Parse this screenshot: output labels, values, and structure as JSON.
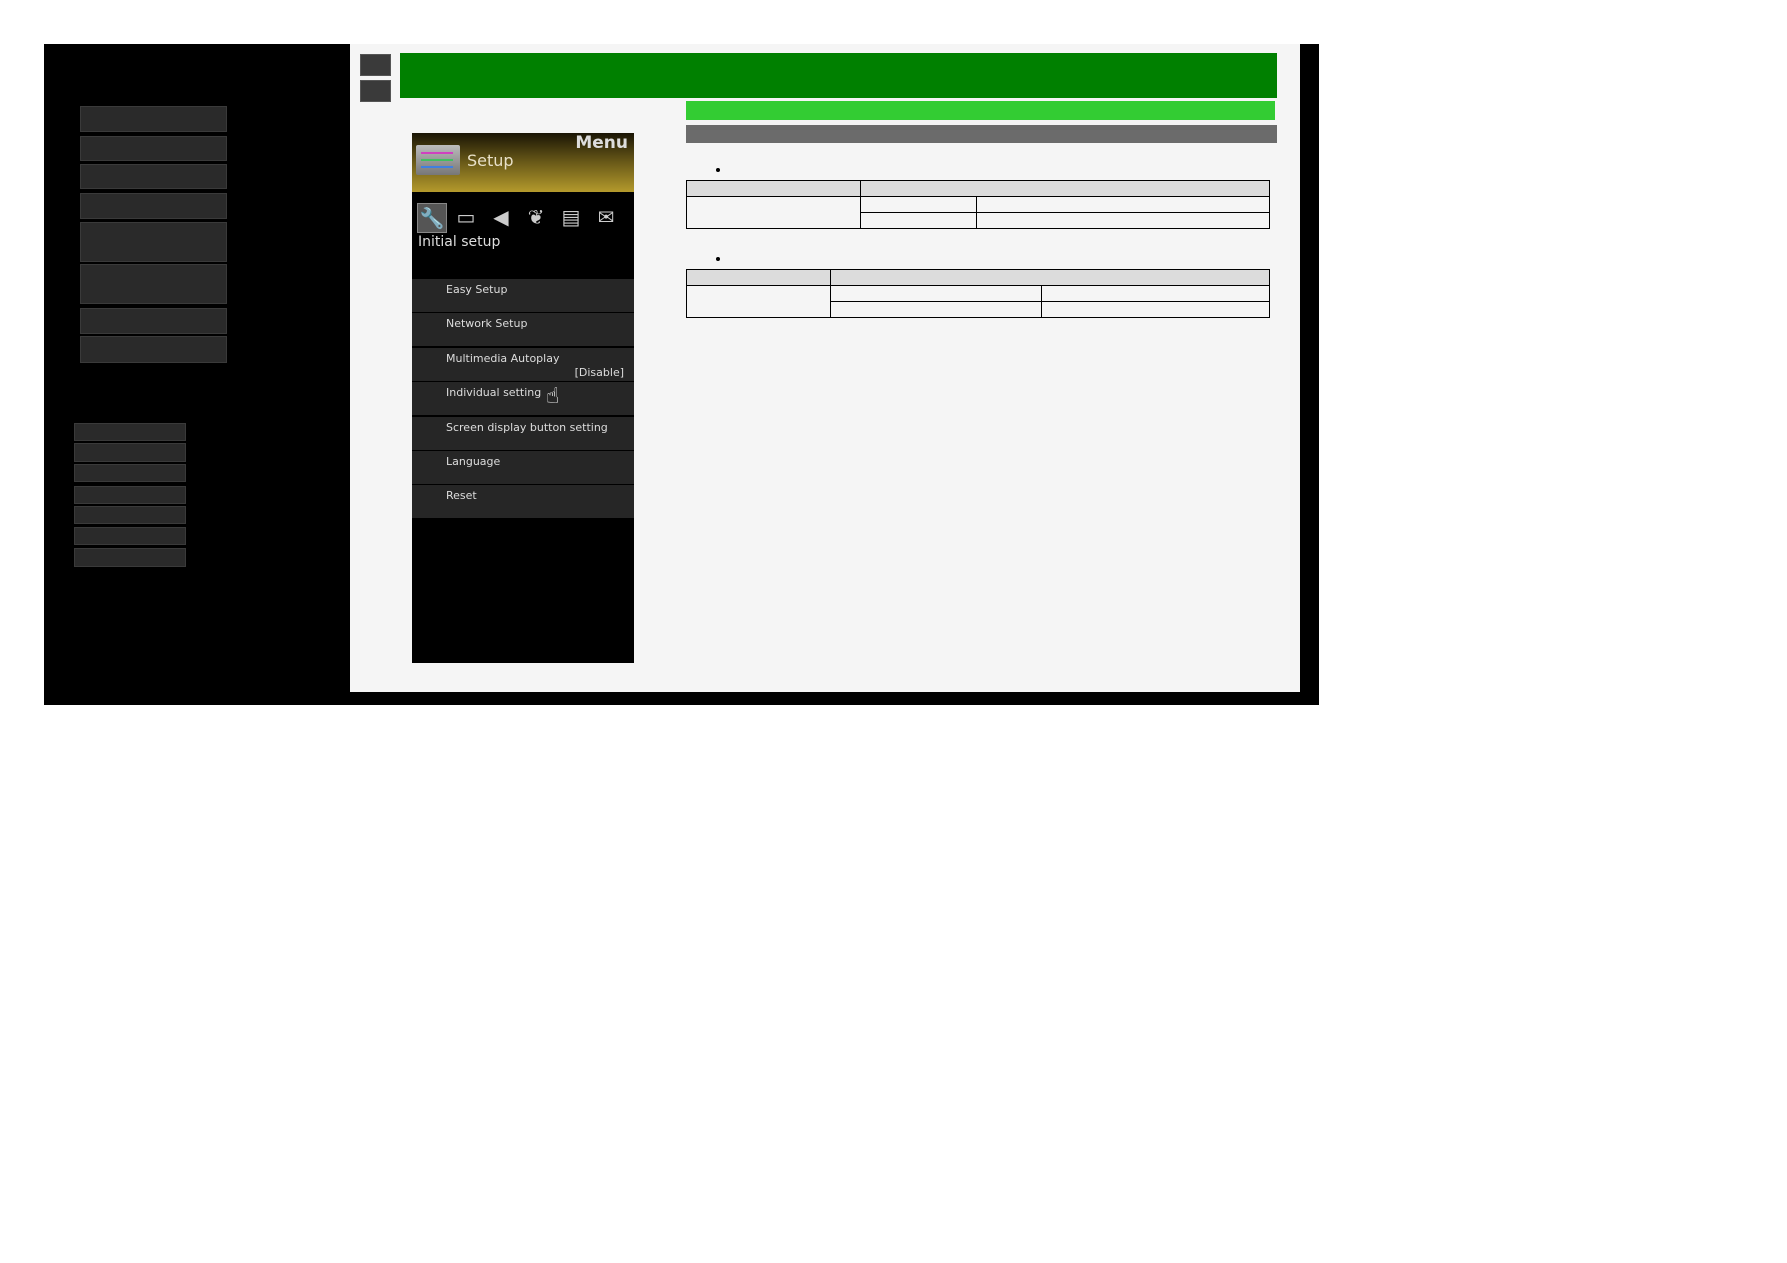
{
  "menu": {
    "title": "Menu",
    "category": "Setup",
    "section": "Initial setup",
    "icons": [
      "wrench-icon",
      "picture-icon",
      "speaker-icon",
      "leaf-icon",
      "toolbox-icon",
      "envelope-icon"
    ],
    "items": [
      {
        "label": "Easy Setup"
      },
      {
        "label": "Network Setup"
      },
      {
        "label": "Multimedia Autoplay",
        "value": "[Disable]"
      },
      {
        "label": "Individual setting"
      },
      {
        "label": "Screen display button setting"
      },
      {
        "label": "Language"
      },
      {
        "label": "Reset"
      }
    ]
  },
  "colors": {
    "header": "#008000",
    "subheader": "#33cc33",
    "bar": "#6b6b6b"
  }
}
